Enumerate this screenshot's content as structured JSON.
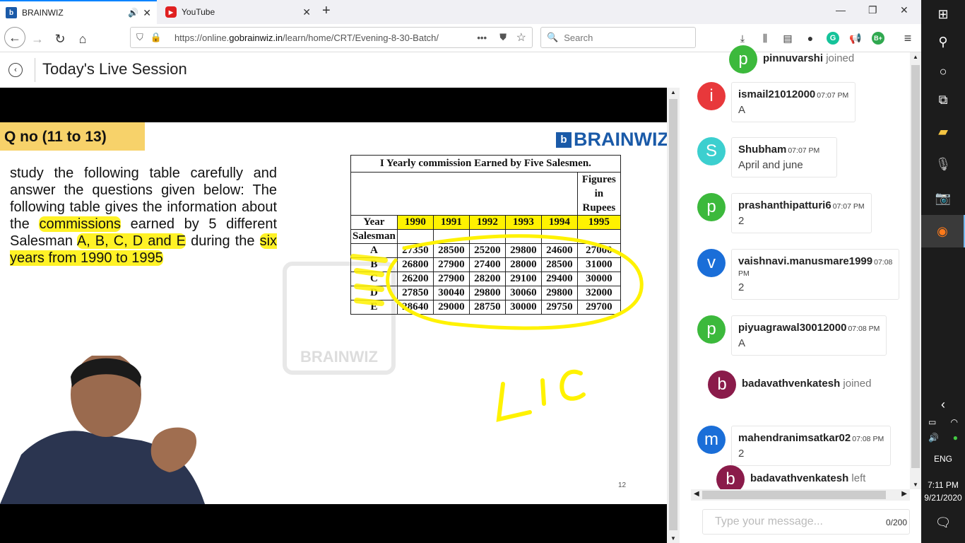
{
  "browser": {
    "tabs": [
      {
        "label": "BRAINWIZ",
        "fav": "b",
        "fav_color": "#1a5aa8"
      },
      {
        "label": "YouTube",
        "fav": "▶",
        "fav_color": "#e02020"
      }
    ],
    "url_prefix": "https://online.",
    "url_domain": "gobrainwiz.in",
    "url_path": "/learn/home/CRT/Evening-8-30-Batch/",
    "search_placeholder": "Search"
  },
  "page": {
    "title": "Today's Live Session"
  },
  "slide": {
    "question_heading": "Q no (11 to 13)",
    "logo_text": "BRAINWIZ",
    "watermark_text": "BRAINWIZ",
    "question_parts": [
      "study the following table carefully and answer the questions given below: The following table gives the information about the ",
      "commissions",
      " earned by 5 different Salesman ",
      "A, B, C, D and E",
      " during the ",
      "six years from 1990  to 1995"
    ],
    "table": {
      "caption": "I Yearly commission Earned by Five Salesmen.",
      "note_lines": [
        "Figures",
        "in",
        "Rupees"
      ],
      "year_label": "Year",
      "salesman_label": "Salesman",
      "years": [
        "1990",
        "1991",
        "1992",
        "1993",
        "1994",
        "1995"
      ],
      "rows": [
        {
          "name": "A",
          "values": [
            "27350",
            "28500",
            "25200",
            "29800",
            "24600",
            "27000"
          ]
        },
        {
          "name": "B",
          "values": [
            "26800",
            "27900",
            "27400",
            "28000",
            "28500",
            "31000"
          ]
        },
        {
          "name": "C",
          "values": [
            "26200",
            "27900",
            "28200",
            "29100",
            "29400",
            "30000"
          ]
        },
        {
          "name": "D",
          "values": [
            "27850",
            "30040",
            "29800",
            "30060",
            "29800",
            "32000"
          ]
        },
        {
          "name": "E",
          "values": [
            "28640",
            "29000",
            "28750",
            "30000",
            "29750",
            "29700"
          ]
        }
      ]
    },
    "page_number": "12",
    "accent_yellow": "#fff200",
    "heading_yellow": "#f7d26a"
  },
  "chat": {
    "messages": [
      {
        "type": "event",
        "user": "pinnuvarshi",
        "event": "joined",
        "initial": "p",
        "color": "#3cb93c"
      },
      {
        "type": "msg",
        "user": "ismail21012000",
        "time": "07:07 PM",
        "text": "A",
        "initial": "i",
        "color": "#e8383b"
      },
      {
        "type": "msg",
        "user": "Shubham",
        "time": "07:07 PM",
        "text": "April and june",
        "initial": "S",
        "color": "#3ccfcf"
      },
      {
        "type": "msg",
        "user": "prashanthipatturi6",
        "time": "07:07 PM",
        "text": "2",
        "initial": "p",
        "color": "#3cb93c"
      },
      {
        "type": "msg",
        "user": "vaishnavi.manusmare1999",
        "time": "07:08 PM",
        "text": "2",
        "initial": "v",
        "color": "#1a6ed8"
      },
      {
        "type": "msg",
        "user": "piyuagrawal30012000",
        "time": "07:08 PM",
        "text": "A",
        "initial": "p",
        "color": "#3cb93c"
      },
      {
        "type": "event",
        "user": "badavathvenkatesh",
        "event": "joined",
        "initial": "b",
        "color": "#8a1b4a"
      },
      {
        "type": "msg",
        "user": "mahendranimsatkar02",
        "time": "07:08 PM",
        "text": "2",
        "initial": "m",
        "color": "#1a6ed8"
      },
      {
        "type": "event",
        "user": "badavathvenkatesh",
        "event": "left",
        "initial": "b",
        "color": "#8a1b4a"
      }
    ],
    "input_placeholder": "Type your message...",
    "char_count": "0/200"
  },
  "taskbar": {
    "language": "ENG",
    "time": "7:11 PM",
    "date": "9/21/2020"
  }
}
